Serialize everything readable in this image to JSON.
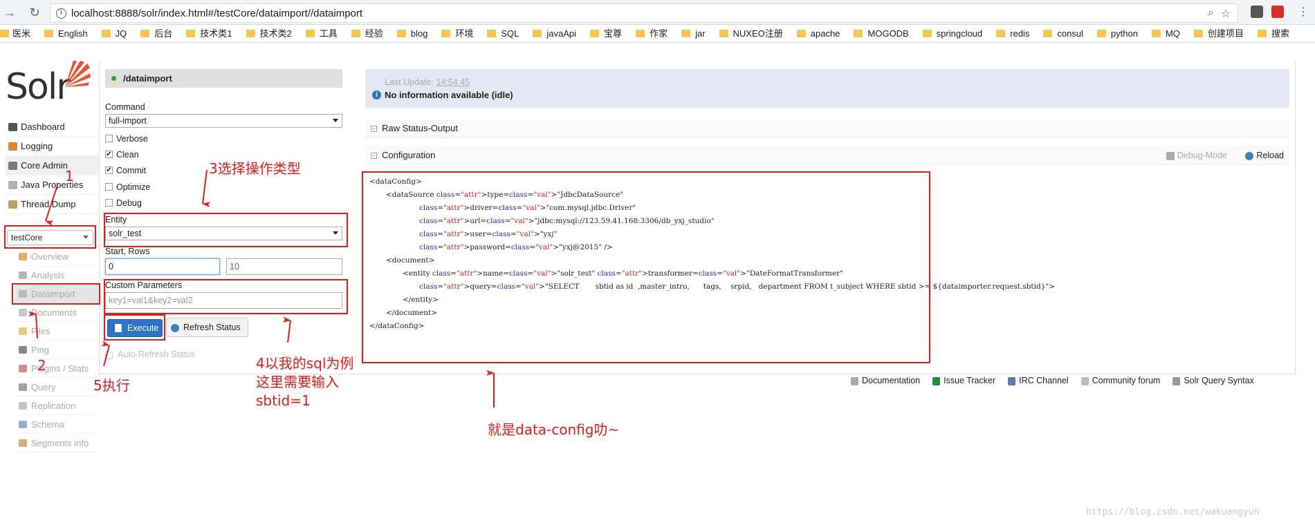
{
  "browser": {
    "url": "localhost:8888/solr/index.html#/testCore/dataimport//dataimport",
    "bookmarks": [
      "医米",
      "English",
      "JQ",
      "后台",
      "技术类1",
      "技术类2",
      "工具",
      "经验",
      "blog",
      "环境",
      "SQL",
      "javaApi",
      "宝尊",
      "作家",
      "jar",
      "NUXEO注册",
      "apache",
      "MOGODB",
      "springcloud",
      "redis",
      "consul",
      "python",
      "MQ",
      "创建项目",
      "搜索"
    ]
  },
  "sidebar": {
    "logo": "Solr",
    "items": [
      {
        "label": "Dashboard",
        "icon": "dashboard-icon"
      },
      {
        "label": "Logging",
        "icon": "logging-icon"
      },
      {
        "label": "Core Admin",
        "icon": "core-admin-icon"
      },
      {
        "label": "Java Properties",
        "icon": "java-icon"
      },
      {
        "label": "Thread Dump",
        "icon": "thread-icon"
      }
    ],
    "core_selector": "testCore",
    "core_items": [
      {
        "label": "Overview",
        "icon": "overview-icon"
      },
      {
        "label": "Analysis",
        "icon": "analysis-icon"
      },
      {
        "label": "Dataimport",
        "icon": "dataimport-icon"
      },
      {
        "label": "Documents",
        "icon": "documents-icon"
      },
      {
        "label": "Files",
        "icon": "files-icon"
      },
      {
        "label": "Ping",
        "icon": "ping-icon"
      },
      {
        "label": "Plugins / Stats",
        "icon": "plugins-icon"
      },
      {
        "label": "Query",
        "icon": "query-icon"
      },
      {
        "label": "Replication",
        "icon": "replication-icon"
      },
      {
        "label": "Schema",
        "icon": "schema-icon"
      },
      {
        "label": "Segments info",
        "icon": "segments-icon"
      }
    ]
  },
  "form": {
    "title": "/dataimport",
    "command_label": "Command",
    "command_value": "full-import",
    "checkboxes": [
      {
        "label": "Verbose",
        "checked": false
      },
      {
        "label": "Clean",
        "checked": true
      },
      {
        "label": "Commit",
        "checked": true
      },
      {
        "label": "Optimize",
        "checked": false
      },
      {
        "label": "Debug",
        "checked": false
      }
    ],
    "entity_label": "Entity",
    "entity_value": "solr_test",
    "start_rows_label": "Start, Rows",
    "start_value": "0",
    "rows_value": "10",
    "custom_label": "Custom Parameters",
    "custom_placeholder": "key1=val1&key2=val2",
    "execute_label": "Execute",
    "refresh_label": "Refresh Status",
    "auto_refresh_label": "Auto-Refresh Status"
  },
  "status": {
    "last_update_label": "Last Update:",
    "last_update_time": "14:54:45",
    "message": "No information available (idle)"
  },
  "sections": {
    "raw_status": "Raw Status-Output",
    "configuration": "Configuration",
    "debug_mode": "Debug-Mode",
    "reload": "Reload"
  },
  "config_lines": [
    {
      "indent": 0,
      "text": "<dataConfig>"
    },
    {
      "indent": 1,
      "text": "<dataSource type=\"JdbcDataSource\""
    },
    {
      "indent": 3,
      "text": "driver=\"com.mysql.jdbc.Driver\""
    },
    {
      "indent": 3,
      "text": "url=\"jdbc:mysql://123.59.41.168:3306/db_yxj_studio\""
    },
    {
      "indent": 3,
      "text": "user=\"yxj\""
    },
    {
      "indent": 3,
      "text": "password=\"yxj@2015\" />"
    },
    {
      "indent": 1,
      "text": "<document>"
    },
    {
      "indent": 2,
      "text": "<entity name=\"solr_test\" transformer=\"DateFormatTransformer\""
    },
    {
      "indent": 3,
      "text": "query=\"SELECT       sbtid as id  ,master_intro,      tags,    srpid,   department FROM t_subject WHERE sbtid >= ${dataimporter.request.sbtid}\">"
    },
    {
      "indent": 2,
      "text": "</entity>"
    },
    {
      "indent": 1,
      "text": "</document>"
    },
    {
      "indent": 0,
      "text": "</dataConfig>"
    }
  ],
  "footer": [
    {
      "label": "Documentation",
      "icon": "documentation-icon"
    },
    {
      "label": "Issue Tracker",
      "icon": "bug-icon"
    },
    {
      "label": "IRC Channel",
      "icon": "irc-icon"
    },
    {
      "label": "Community forum",
      "icon": "forum-icon"
    },
    {
      "label": "Solr Query Syntax",
      "icon": "syntax-icon"
    }
  ],
  "annotations": {
    "a1": "1",
    "a2": "2",
    "a3": "3选择操作类型",
    "a4": "4以我的sql为例\n这里需要输入\nsbtid=1",
    "a5": "5执行",
    "a6": "就是data-config叻~"
  },
  "watermark": "https://blog.csdn.net/wakuangyun",
  "colors": {
    "annotation": "#e81a1a",
    "execute": "#2c74c6",
    "status_bg": "#e6e7f4"
  }
}
